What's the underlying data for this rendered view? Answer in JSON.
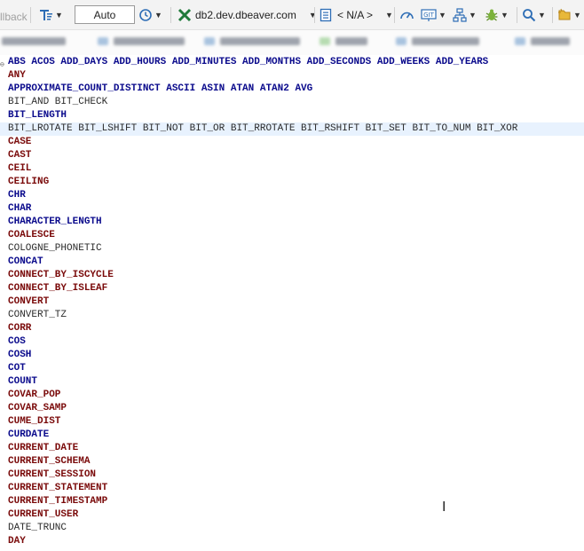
{
  "toolbar": {
    "rollback_label": "llback",
    "transaction_mode": "Auto",
    "connection": "db2.dev.dbeaver.com",
    "schema": "< N/A >",
    "icons": [
      "transaction-mode-icon",
      "history-icon",
      "connection-icon",
      "schema-icon",
      "dashboard-icon",
      "git-icon",
      "network-icon",
      "debug-icon",
      "search-icon",
      "bookmark-icon"
    ]
  },
  "colors": {
    "blue": "#0a0a8c",
    "red": "#7a0a0a",
    "plain": "#2b2b2b",
    "highlight": "#e8f2fe"
  },
  "lines": [
    {
      "text": "ABS ACOS ADD_DAYS ADD_HOURS ADD_MINUTES ADD_MONTHS ADD_SECONDS ADD_WEEKS ADD_YEARS",
      "color": "blue",
      "bold": true
    },
    {
      "text": "ANY",
      "color": "red",
      "bold": true
    },
    {
      "text": "APPROXIMATE_COUNT_DISTINCT ASCII ASIN ATAN ATAN2 AVG",
      "color": "blue",
      "bold": true
    },
    {
      "text": "BIT_AND BIT_CHECK",
      "color": "plain",
      "bold": false
    },
    {
      "text": "BIT_LENGTH",
      "color": "blue",
      "bold": true
    },
    {
      "text": "BIT_LROTATE BIT_LSHIFT BIT_NOT BIT_OR BIT_RROTATE BIT_RSHIFT BIT_SET BIT_TO_NUM BIT_XOR",
      "color": "plain",
      "bold": false,
      "highlight": true
    },
    {
      "text": "CASE",
      "color": "red",
      "bold": true
    },
    {
      "text": "CAST",
      "color": "red",
      "bold": true
    },
    {
      "text": "CEIL",
      "color": "red",
      "bold": true
    },
    {
      "text": "CEILING",
      "color": "red",
      "bold": true
    },
    {
      "text": "CHR",
      "color": "blue",
      "bold": true
    },
    {
      "text": "CHAR",
      "color": "blue",
      "bold": true
    },
    {
      "text": "CHARACTER_LENGTH",
      "color": "blue",
      "bold": true
    },
    {
      "text": "COALESCE",
      "color": "red",
      "bold": true
    },
    {
      "text": "COLOGNE_PHONETIC",
      "color": "plain",
      "bold": false
    },
    {
      "text": "CONCAT",
      "color": "blue",
      "bold": true
    },
    {
      "text": "CONNECT_BY_ISCYCLE",
      "color": "red",
      "bold": true
    },
    {
      "text": "CONNECT_BY_ISLEAF",
      "color": "red",
      "bold": true
    },
    {
      "text": "CONVERT",
      "color": "red",
      "bold": true
    },
    {
      "text": "CONVERT_TZ",
      "color": "plain",
      "bold": false
    },
    {
      "text": "CORR",
      "color": "red",
      "bold": true
    },
    {
      "text": "COS",
      "color": "blue",
      "bold": true
    },
    {
      "text": "COSH",
      "color": "blue",
      "bold": true
    },
    {
      "text": "COT",
      "color": "blue",
      "bold": true
    },
    {
      "text": "COUNT",
      "color": "blue",
      "bold": true
    },
    {
      "text": "COVAR_POP",
      "color": "red",
      "bold": true
    },
    {
      "text": "COVAR_SAMP",
      "color": "red",
      "bold": true
    },
    {
      "text": "CUME_DIST",
      "color": "red",
      "bold": true
    },
    {
      "text": "CURDATE",
      "color": "blue",
      "bold": true
    },
    {
      "text": "CURRENT_DATE",
      "color": "red",
      "bold": true
    },
    {
      "text": "CURRENT_SCHEMA",
      "color": "red",
      "bold": true
    },
    {
      "text": "CURRENT_SESSION",
      "color": "red",
      "bold": true
    },
    {
      "text": "CURRENT_STATEMENT",
      "color": "red",
      "bold": true
    },
    {
      "text": "CURRENT_TIMESTAMP",
      "color": "red",
      "bold": true
    },
    {
      "text": "CURRENT_USER",
      "color": "red",
      "bold": true
    },
    {
      "text": "DATE_TRUNC",
      "color": "plain",
      "bold": false
    },
    {
      "text": "DAY",
      "color": "red",
      "bold": true
    }
  ]
}
